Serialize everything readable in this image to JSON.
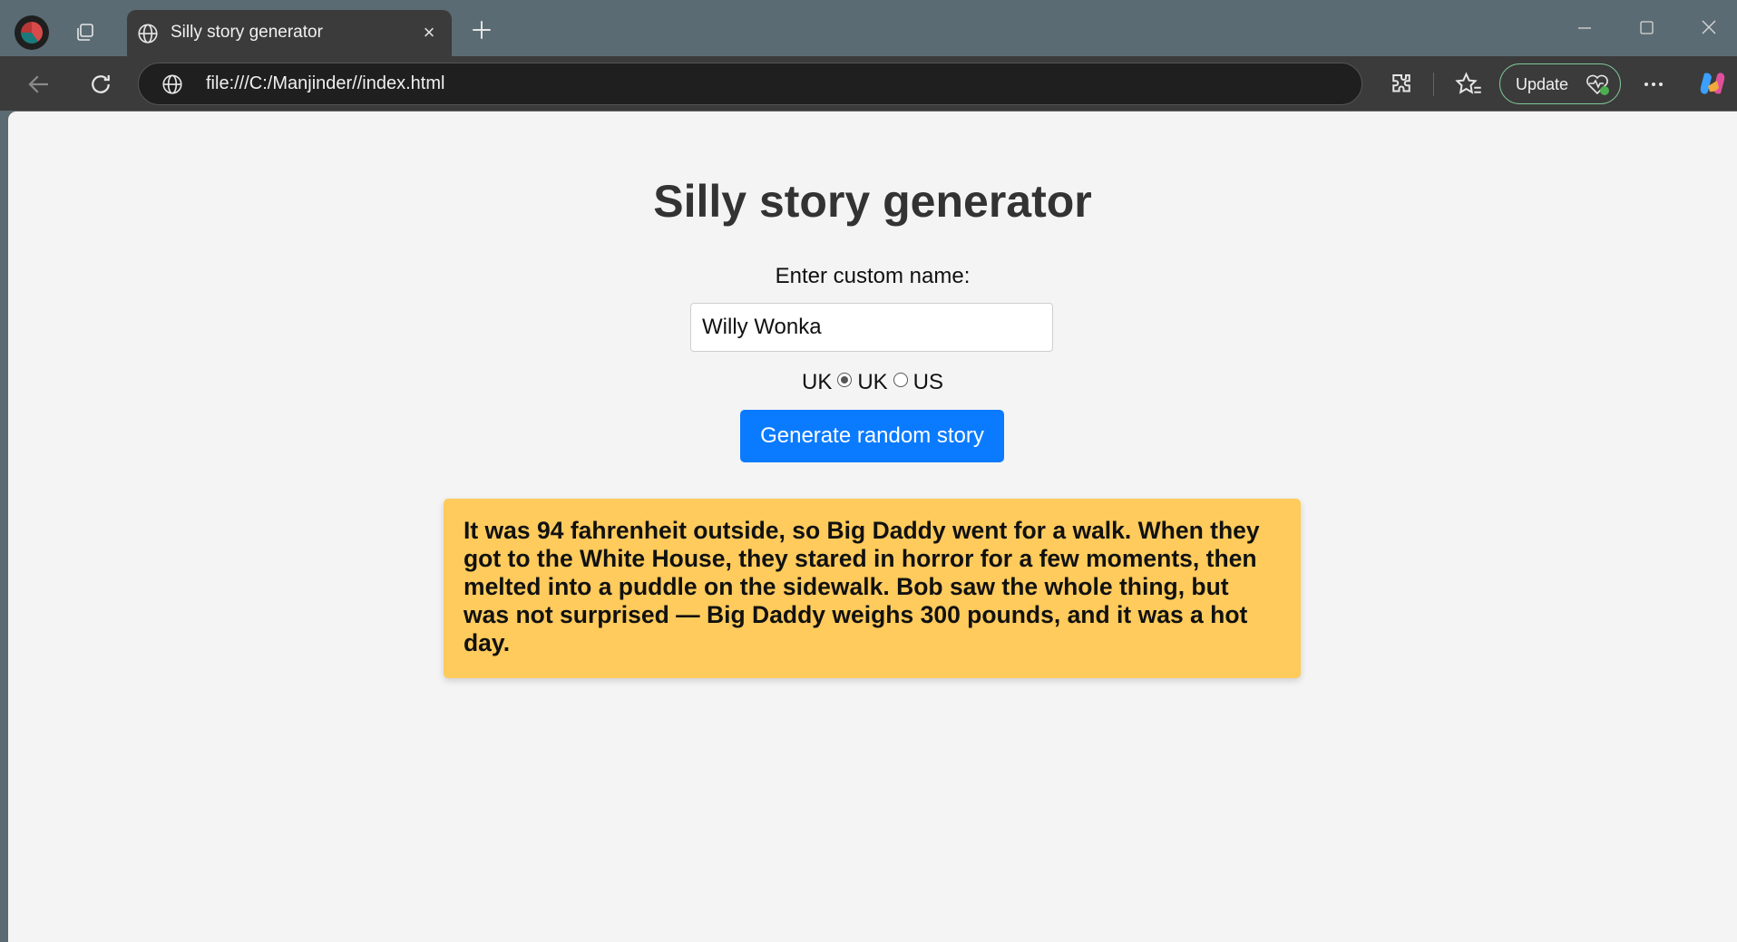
{
  "browser": {
    "tab_title": "Silly story generator",
    "tab_close": "×",
    "url": "file:///C:/Manjinder//index.html",
    "update_label": "Update"
  },
  "page": {
    "title": "Silly story generator",
    "name_label": "Enter custom name:",
    "name_value": "Willy Wonka",
    "radio_prefix": "UK",
    "radio_options": [
      {
        "label": "UK",
        "checked": true
      },
      {
        "label": "US",
        "checked": false
      }
    ],
    "generate_label": "Generate random story",
    "story": "It was 94 fahrenheit outside, so Big Daddy went for a walk. When they got to the White House, they stared in horror for a few moments, then melted into a puddle on the sidewalk. Bob saw the whole thing, but was not surprised — Big Daddy weighs 300 pounds, and it was a hot day."
  },
  "colors": {
    "tabstrip_bg": "#5b6b73",
    "toolbar_bg": "#3b3b3b",
    "page_bg": "#f4f4f4",
    "button_blue": "#0a7bff",
    "story_bg": "#ffcb5c",
    "update_border": "#7fc69a"
  }
}
